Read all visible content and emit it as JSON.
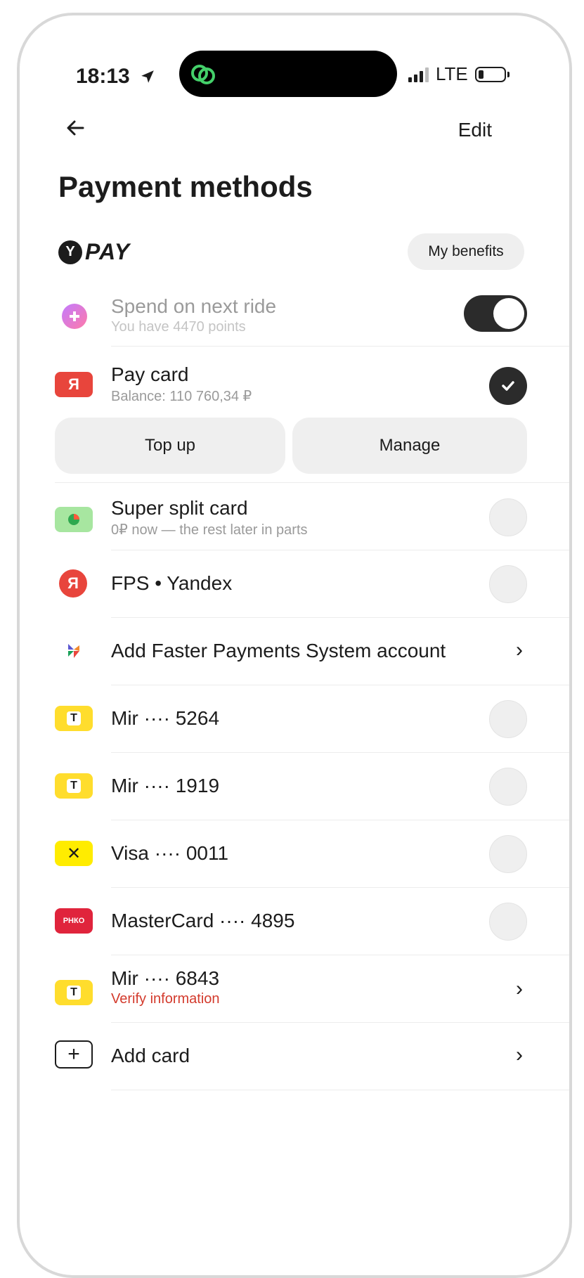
{
  "status_bar": {
    "time": "18:13",
    "network": "LTE"
  },
  "header": {
    "edit_label": "Edit",
    "title": "Payment methods"
  },
  "ypay": {
    "logo_text": "PAY",
    "benefits_label": "My benefits"
  },
  "points": {
    "title": "Spend on next ride",
    "subtitle": "You have 4470 points",
    "toggle_on": true
  },
  "pay_card": {
    "title": "Pay card",
    "subtitle": "Balance: 110 760,34 ₽",
    "icon_text": "Я",
    "top_up_label": "Top up",
    "manage_label": "Manage"
  },
  "methods": [
    {
      "title": "Super split card",
      "subtitle": "0₽ now — the rest later in parts",
      "icon": "split-card-icon"
    },
    {
      "title": "FPS • Yandex",
      "icon": "yandex-icon",
      "icon_text": "Я"
    },
    {
      "title": "Add Faster Payments System account",
      "icon": "fps-icon"
    },
    {
      "title": "Mir ···· 5264",
      "icon": "tbank-icon",
      "icon_text": "T"
    },
    {
      "title": "Mir ···· 1919",
      "icon": "tbank-icon",
      "icon_text": "T"
    },
    {
      "title": "Visa ···· 0011",
      "icon": "raiffeisen-icon",
      "icon_text": "✕"
    },
    {
      "title": "MasterCard ···· 4895",
      "icon": "rnko-icon",
      "icon_text": "РНКО"
    },
    {
      "title": "Mir ···· 6843",
      "subtitle": "Verify information",
      "icon": "tbank-icon",
      "icon_text": "T"
    },
    {
      "title": "Add card",
      "icon": "plus-icon",
      "icon_text": "+"
    }
  ],
  "colors": {
    "accent_red": "#e8453c",
    "warning_text": "#d33a2c",
    "mir_yellow": "#ffdd2d",
    "dark": "#2b2b2b"
  }
}
